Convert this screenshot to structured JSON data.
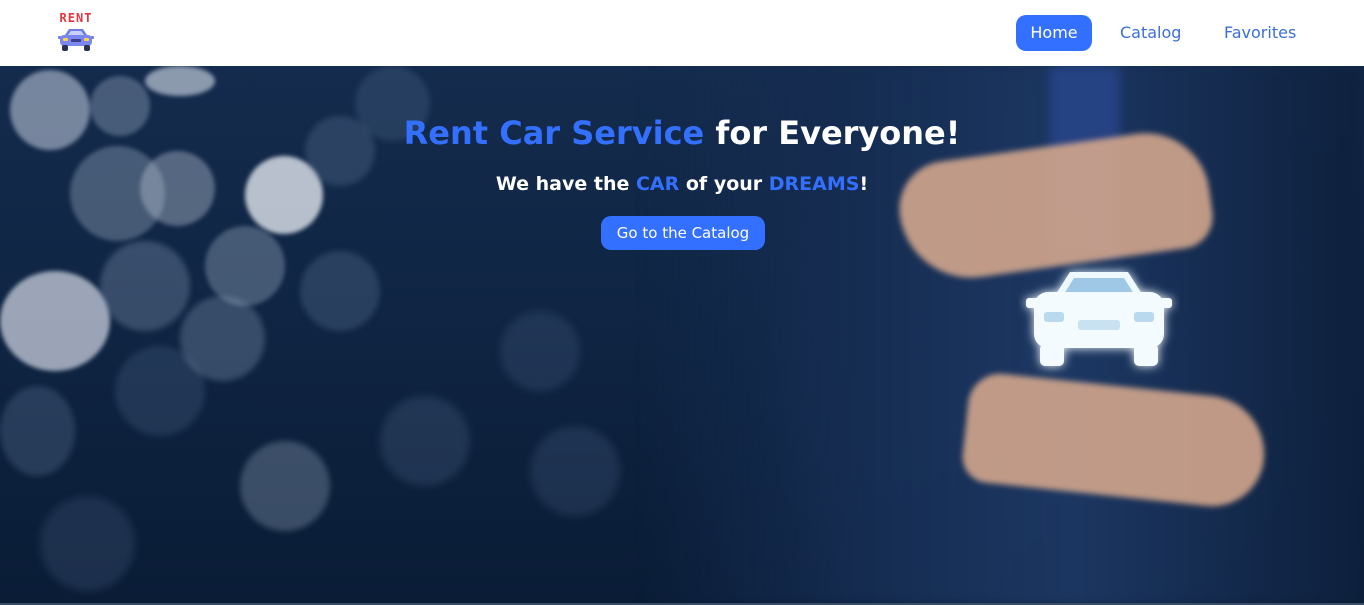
{
  "logo": {
    "text": "RENT",
    "icon": "car-icon"
  },
  "nav": {
    "items": [
      {
        "label": "Home",
        "active": true
      },
      {
        "label": "Catalog",
        "active": false
      },
      {
        "label": "Favorites",
        "active": false
      }
    ]
  },
  "hero": {
    "title_accent": "Rent Car Service",
    "title_rest": " for Everyone!",
    "subtitle_part1": "We have the ",
    "subtitle_accent1": "CAR",
    "subtitle_part2": " of your ",
    "subtitle_accent2": "DREAMS",
    "subtitle_part3": "!",
    "cta_label": "Go to the Catalog",
    "image_icon": "glowing-car-icon"
  },
  "colors": {
    "accent": "#3470ff",
    "logo_red": "#e2373f",
    "nav_text": "#3b6fd4",
    "hero_dark": "#0f2543"
  }
}
